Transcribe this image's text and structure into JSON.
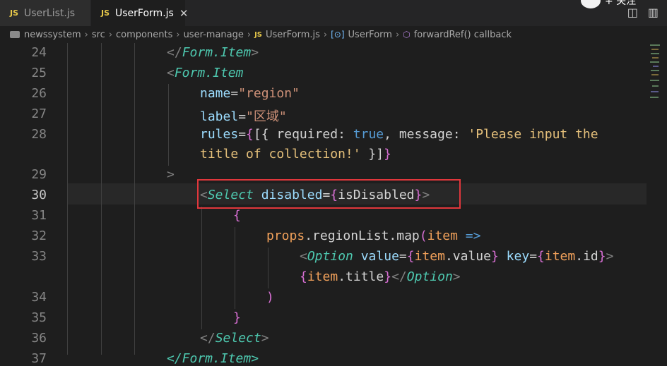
{
  "tabs": [
    {
      "icon": "JS",
      "label": "UserList.js"
    },
    {
      "icon": "JS",
      "label": "UserForm.js",
      "close": "✕"
    }
  ],
  "follow": {
    "text": "+ 关注"
  },
  "breadcrumb": {
    "items": [
      "newssystem",
      "src",
      "components",
      "user-manage",
      "UserForm.js",
      "UserForm",
      "forwardRef() callback"
    ],
    "file_icon": "JS"
  },
  "lines": {
    "n24": "24",
    "n25": "25",
    "n26": "26",
    "n27": "27",
    "n28": "28",
    "n29": "29",
    "n30": "30",
    "n31": "31",
    "n32": "32",
    "n33": "33",
    "n34": "34",
    "n35": "35",
    "n36": "36",
    "n37": "37"
  },
  "code": {
    "l24_open": "</",
    "l24_cmp": "Form.Item",
    "l24_close": ">",
    "l25_open": "<",
    "l25_cmp": "Form.Item",
    "l26_attr": "name",
    "l26_eq": "=",
    "l26_str": "\"region\"",
    "l27_attr": "label",
    "l27_eq": "=",
    "l27_str": "\"区域\"",
    "l28_attr": "rules",
    "l28_eq": "=",
    "l28_b1": "{",
    "l28_b2": "[{ ",
    "l28_key1": "required",
    "l28_colon1": ": ",
    "l28_true": "true",
    "l28_comma": ", ",
    "l28_key2": "message",
    "l28_colon2": ": ",
    "l28_msg1": "'Please input the",
    "l28b_msg2": "title of collection!'",
    "l28b_close1": " }]",
    "l28b_close2": "}",
    "l29_gt": ">",
    "l30_open": "<",
    "l30_cmp": "Select",
    "l30_attr_a": "di",
    "l30_attr_b": "sabled",
    "l30_eq": "=",
    "l30_b1": "{",
    "l30_val": "isDisabled",
    "l30_b2": "}",
    "l30_close": ">",
    "l31_b": "{",
    "l32_props": "props",
    "l32_dot": ".",
    "l32_list": "regionList",
    "l32_map": ".map",
    "l32_paren": "(",
    "l32_item": "item",
    "l32_arrow": " =>",
    "l33_open": "<",
    "l33_cmp": "Option",
    "l33_attr1": "value",
    "l33_eq1": "=",
    "l33_b1": "{",
    "l33_item1": "item",
    "l33_prop1": ".value",
    "l33_b2": "}",
    "l33_attr2": "key",
    "l33_eq2": "=",
    "l33_b3": "{",
    "l33_item2": "item",
    "l33_prop2": ".id",
    "l33_b4": "}",
    "l33_close": ">",
    "l33b_b1": "{",
    "l33b_item": "item",
    "l33b_prop": ".title",
    "l33b_b2": "}",
    "l33b_open": "</",
    "l33b_cmp": "Option",
    "l33b_close": ">",
    "l34_paren": ")",
    "l35_b": "}",
    "l36_open": "</",
    "l36_cmp": "Select",
    "l36_close": ">",
    "l37_text": "</Form.Item>"
  },
  "colors": {
    "highlight_box": "#e0373c",
    "tag_js": "#e8c94a",
    "background": "#1e1e1e"
  }
}
